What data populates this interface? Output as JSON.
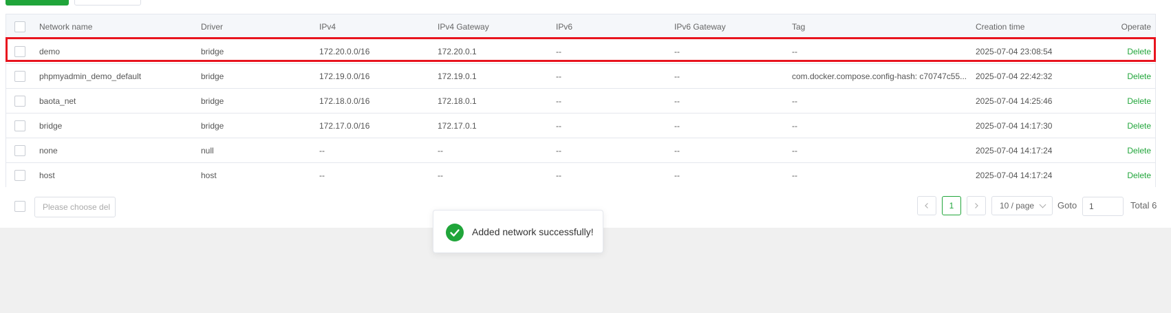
{
  "toolbar": {
    "primary_color": "#20a53a"
  },
  "table": {
    "headers": {
      "name": "Network name",
      "driver": "Driver",
      "ipv4": "IPv4",
      "ipv4_gateway": "IPv4 Gateway",
      "ipv6": "IPv6",
      "ipv6_gateway": "IPv6 Gateway",
      "tag": "Tag",
      "creation_time": "Creation time",
      "operate": "Operate"
    },
    "rows": [
      {
        "name": "demo",
        "driver": "bridge",
        "ipv4": "172.20.0.0/16",
        "ipv4_gateway": "172.20.0.1",
        "ipv6": "--",
        "ipv6_gateway": "--",
        "tag": "--",
        "creation_time": "2025-07-04 23:08:54",
        "operate": "Delete"
      },
      {
        "name": "phpmyadmin_demo_default",
        "driver": "bridge",
        "ipv4": "172.19.0.0/16",
        "ipv4_gateway": "172.19.0.1",
        "ipv6": "--",
        "ipv6_gateway": "--",
        "tag": "com.docker.compose.config-hash: c70747c55...",
        "creation_time": "2025-07-04 22:42:32",
        "operate": "Delete"
      },
      {
        "name": "baota_net",
        "driver": "bridge",
        "ipv4": "172.18.0.0/16",
        "ipv4_gateway": "172.18.0.1",
        "ipv6": "--",
        "ipv6_gateway": "--",
        "tag": "--",
        "creation_time": "2025-07-04 14:25:46",
        "operate": "Delete"
      },
      {
        "name": "bridge",
        "driver": "bridge",
        "ipv4": "172.17.0.0/16",
        "ipv4_gateway": "172.17.0.1",
        "ipv6": "--",
        "ipv6_gateway": "--",
        "tag": "--",
        "creation_time": "2025-07-04 14:17:30",
        "operate": "Delete"
      },
      {
        "name": "none",
        "driver": "null",
        "ipv4": "--",
        "ipv4_gateway": "--",
        "ipv6": "--",
        "ipv6_gateway": "--",
        "tag": "--",
        "creation_time": "2025-07-04 14:17:24",
        "operate": "Delete"
      },
      {
        "name": "host",
        "driver": "host",
        "ipv4": "--",
        "ipv4_gateway": "--",
        "ipv6": "--",
        "ipv6_gateway": "--",
        "tag": "--",
        "creation_time": "2025-07-04 14:17:24",
        "operate": "Delete"
      }
    ]
  },
  "highlight": {
    "row": "demo",
    "color": "#e8141e"
  },
  "footer": {
    "batch_placeholder": "Please choose del",
    "prev_icon": "chevron-left-icon",
    "current_page": "1",
    "next_icon": "chevron-right-icon",
    "page_size": "10 / page",
    "goto_label": "Goto",
    "goto_value": "1",
    "total": "Total 6"
  },
  "toast": {
    "icon": "check-circle-icon",
    "message": "Added network successfully!",
    "color": "#20a53a"
  }
}
